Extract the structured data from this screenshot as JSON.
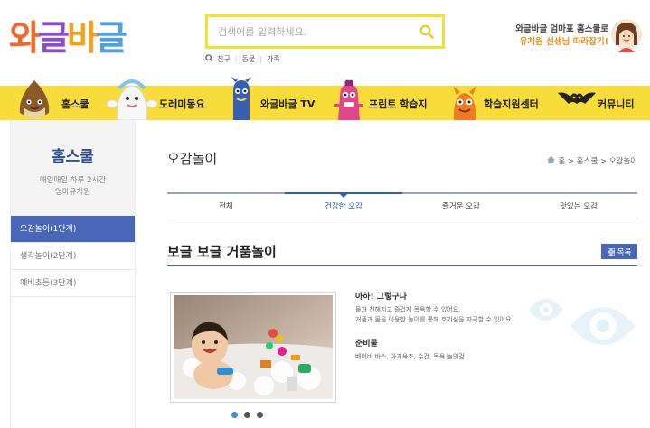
{
  "header": {
    "logo_chars": [
      "와",
      "글",
      "바",
      "글"
    ],
    "logo_colors": [
      "#ef6a2a",
      "#8a4fc8",
      "#f3a21c",
      "#4f9fd8"
    ],
    "search_placeholder": "검색어를 입력하세요.",
    "search_links": [
      "친구",
      "동물",
      "가족"
    ],
    "promo_line1": "와글바글 엄마표 홈스쿨로",
    "promo_line2": "유치원 선생님 따라잡기!"
  },
  "nav": {
    "items": [
      {
        "label": "홈스쿨",
        "icon": "chestnut-character-icon"
      },
      {
        "label": "도레미동요",
        "icon": "ghost-character-icon"
      },
      {
        "label": "와글바글 TV",
        "icon": "blue-monster-character-icon"
      },
      {
        "label": "프린트 학습지",
        "icon": "pink-monster-character-icon"
      },
      {
        "label": "학습지원센터",
        "icon": "orange-monster-character-icon"
      },
      {
        "label": "커뮤니티",
        "icon": "bat-character-icon"
      }
    ]
  },
  "sidebar": {
    "title": "홈스쿨",
    "desc1": "매일매일 하루 2시간",
    "desc2": "엄마유치원",
    "items": [
      {
        "label": "오감놀이(1단계)",
        "active": true
      },
      {
        "label": "생각놀이(2단계)",
        "active": false
      },
      {
        "label": "예비초등(3단계)",
        "active": false
      }
    ]
  },
  "main": {
    "page_title": "오감놀이",
    "breadcrumb": "홈 > 홈스쿨 > 오감놀이",
    "tabs": [
      {
        "label": "전체",
        "active": false
      },
      {
        "label": "건강한 오감",
        "active": true
      },
      {
        "label": "즐거운 오감",
        "active": false
      },
      {
        "label": "맛있는 오감",
        "active": false
      }
    ],
    "content_title": "보글 보글 거품놀이",
    "list_button": "목록",
    "info": {
      "heading1": "아하! 그렇구나",
      "text1a": "물과 친해지고 즐겁게 목욕할 수 있어요.",
      "text1b": "거품과 물을 이용한 놀이를 통해 호기심을 자극할 수 있어요.",
      "heading2": "준비물",
      "text2": "베이비 바스, 아기욕조, 수건, 목욕 놀잇감"
    },
    "slider_dots": 3,
    "slider_active": 0
  },
  "colors": {
    "nav_bg": "#f7dc3b",
    "accent_blue": "#4a66b8",
    "search_border": "#f2df38"
  }
}
